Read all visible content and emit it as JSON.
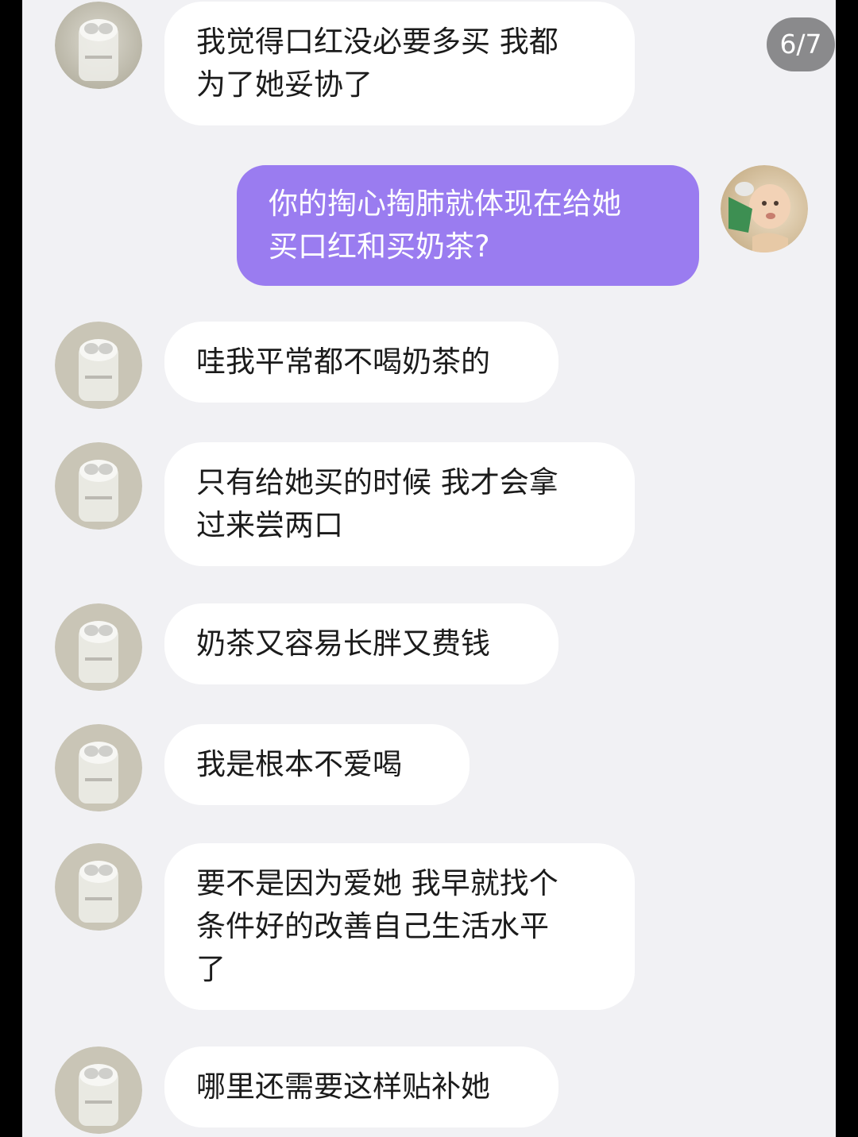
{
  "viewer": {
    "page_indicator": "6/7"
  },
  "colors": {
    "incoming_bubble": "#ffffff",
    "outgoing_bubble": "#9a7cf0",
    "background": "#f1f1f4"
  },
  "messages": [
    {
      "sender": "other",
      "text": "我觉得口红没必要多买 我都\n为了她妥协了"
    },
    {
      "sender": "me",
      "text": "你的掏心掏肺就体现在给她\n买口红和买奶茶?"
    },
    {
      "sender": "other",
      "text": "哇我平常都不喝奶茶的"
    },
    {
      "sender": "other",
      "text": "只有给她买的时候 我才会拿\n过来尝两口"
    },
    {
      "sender": "other",
      "text": "奶茶又容易长胖又费钱"
    },
    {
      "sender": "other",
      "text": "我是根本不爱喝"
    },
    {
      "sender": "other",
      "text": "要不是因为爱她 我早就找个\n条件好的改善自己生活水平\n了"
    },
    {
      "sender": "other",
      "text": "哪里还需要这样贴补她"
    }
  ],
  "avatars": {
    "other": "bottle-avatar-icon",
    "me": "baby-photo-avatar-icon"
  }
}
